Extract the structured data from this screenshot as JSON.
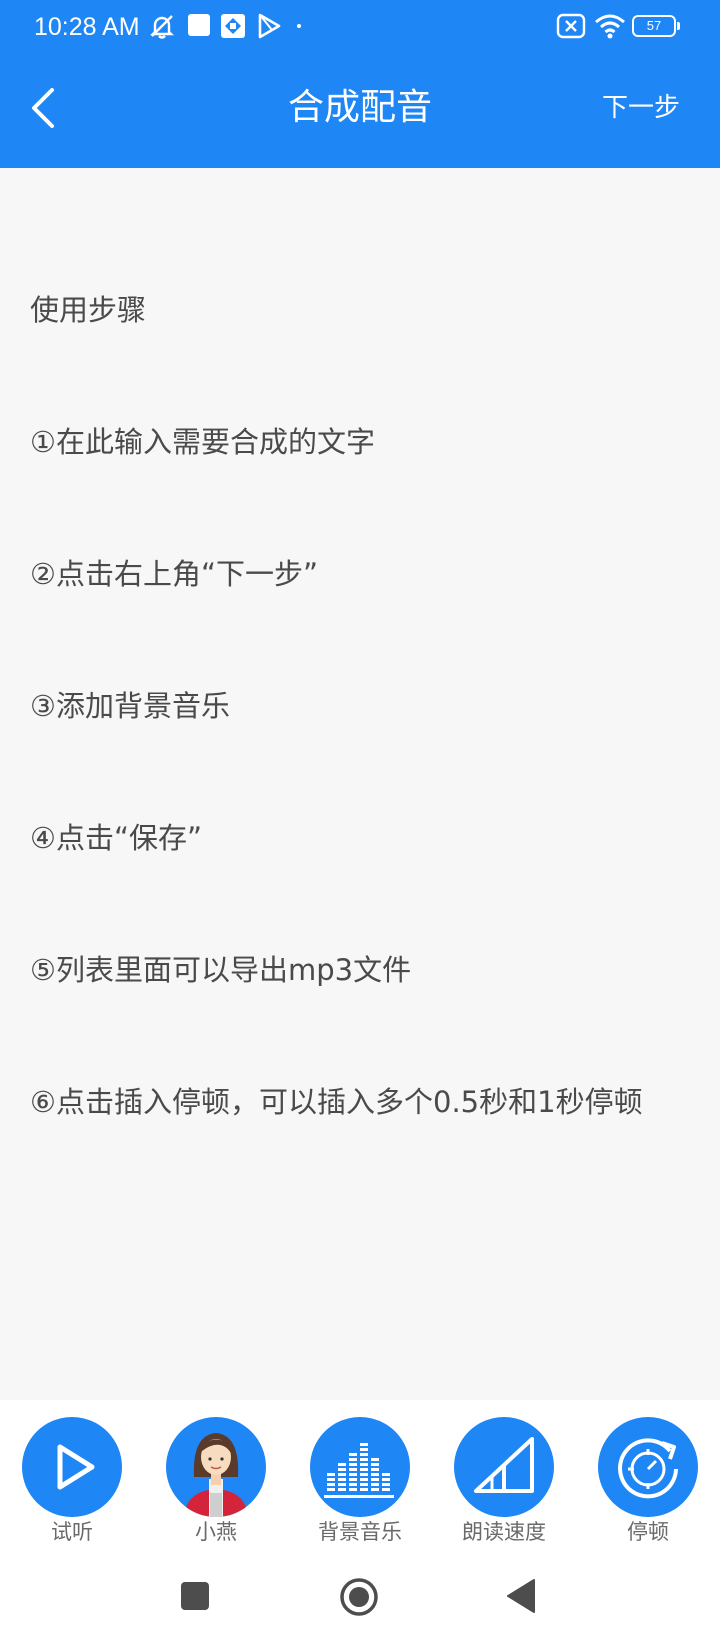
{
  "status_bar": {
    "time": "10:28 AM",
    "battery": "57",
    "icons": [
      "mute-alarm-icon",
      "square-icon",
      "box-app-icon",
      "play-store-icon",
      "dot-icon",
      "sim-off-icon",
      "wifi-icon",
      "battery-icon"
    ]
  },
  "header": {
    "title": "合成配音",
    "next_label": "下一步",
    "back_icon": "chevron-left-icon"
  },
  "instructions": {
    "heading": "使用步骤",
    "steps": [
      "①在此输入需要合成的文字",
      "②点击右上角“下一步”",
      "③添加背景音乐",
      "④点击“保存”",
      "⑤列表里面可以导出mp3文件",
      "⑥点击插入停顿，可以插入多个0.5秒和1秒停顿"
    ]
  },
  "toolbar": {
    "items": [
      {
        "label": "试听",
        "icon": "play-icon"
      },
      {
        "label": "小燕",
        "icon": "voice-avatar"
      },
      {
        "label": "背景音乐",
        "icon": "equalizer-icon"
      },
      {
        "label": "朗读速度",
        "icon": "speed-ramp-icon"
      },
      {
        "label": "停顿",
        "icon": "pause-timer-icon"
      }
    ]
  },
  "nav_bar": {
    "icons": [
      "recents-square-icon",
      "home-circle-icon",
      "back-triangle-icon"
    ]
  },
  "colors": {
    "primary": "#1f86f6",
    "background": "#f7f7f7",
    "text": "#4a4a4a"
  }
}
